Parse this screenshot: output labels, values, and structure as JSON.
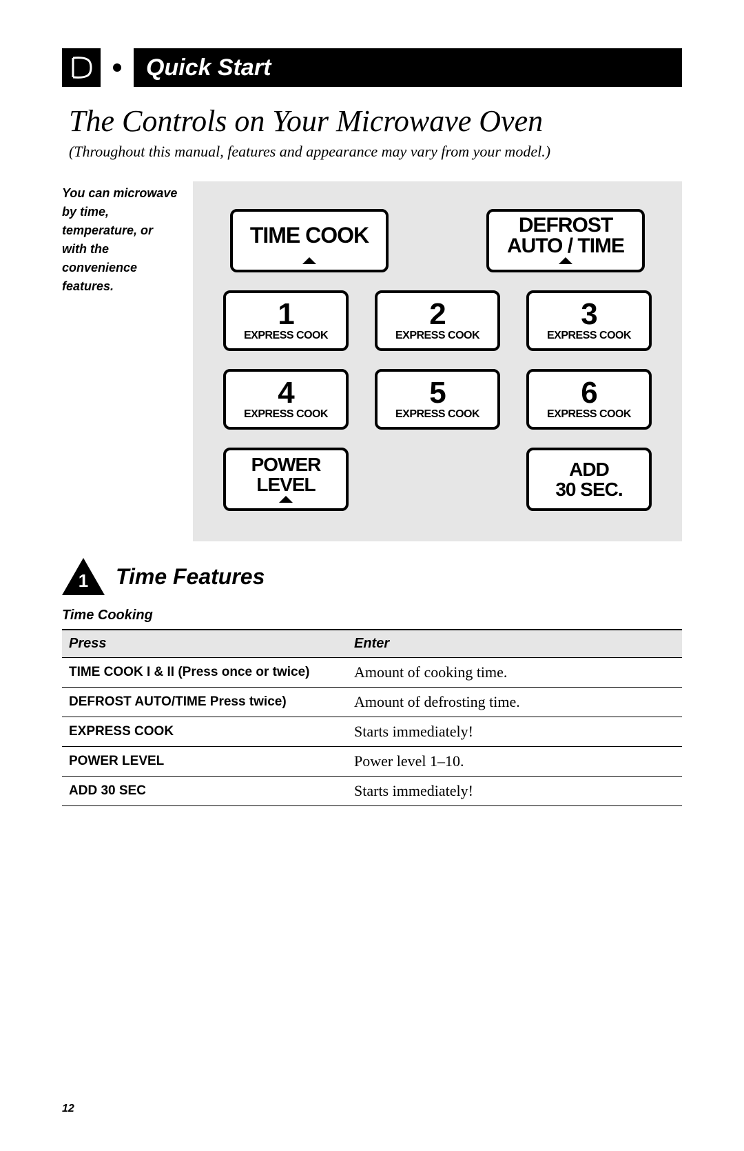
{
  "header": {
    "title": "Quick Start"
  },
  "title": "The Controls on Your Microwave Oven",
  "subtitle": "(Throughout this manual, features and appearance may vary from your model.)",
  "side_note": "You can microwave by time, temperature, or with the convenience features.",
  "panel": {
    "time_cook": "TIME COOK",
    "defrost_line1": "DEFROST",
    "defrost_line2": "AUTO / TIME",
    "express": "EXPRESS COOK",
    "nums": [
      "1",
      "2",
      "3",
      "4",
      "5",
      "6"
    ],
    "power_line1": "POWER",
    "power_line2": "LEVEL",
    "add30_line1": "ADD",
    "add30_line2": "30 SEC."
  },
  "section": {
    "num": "1",
    "title": "Time Features"
  },
  "table": {
    "subhead": "Time Cooking",
    "col_press": "Press",
    "col_enter": "Enter",
    "rows": [
      {
        "press": "TIME COOK I & II (Press once or twice)",
        "enter": "Amount of cooking time."
      },
      {
        "press": "DEFROST AUTO/TIME Press twice)",
        "enter": "Amount of defrosting time."
      },
      {
        "press": "EXPRESS COOK",
        "enter": "Starts immediately!"
      },
      {
        "press": "POWER LEVEL",
        "enter": "Power level 1–10."
      },
      {
        "press": "ADD 30 SEC",
        "enter": "Starts immediately!"
      }
    ]
  },
  "page_number": "12"
}
